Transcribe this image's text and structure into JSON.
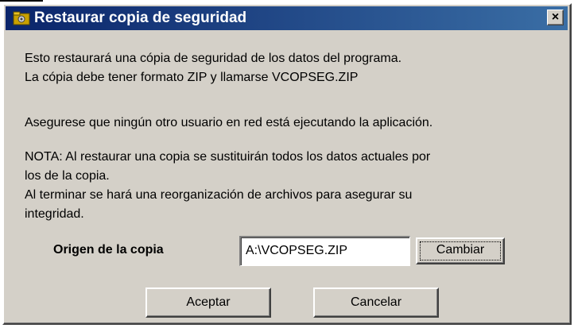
{
  "dialog": {
    "title": "Restaurar copia de seguridad",
    "close_glyph": "×",
    "icons": {
      "title": "folder-icon",
      "close": "close-icon"
    },
    "paragraphs": [
      "Esto restaurará una cópia de seguridad de los datos del programa.",
      "La cópia debe tener formato ZIP y llamarse VCOPSEG.ZIP",
      "Asegurese que ningún otro usuario en red está ejecutando la aplicación.",
      "NOTA: Al restaurar una copia se sustituirán todos los datos actuales por",
      "los de la copia.",
      "Al terminar se hará una reorganización de archivos para asegurar su",
      "integridad."
    ],
    "origin": {
      "label": "Origen de la copia",
      "value": "A:\\VCOPSEG.ZIP",
      "change_button": "Cambiar"
    },
    "buttons": {
      "accept": "Aceptar",
      "cancel": "Cancelar"
    },
    "colors": {
      "titlebar_start": "#0a246a",
      "titlebar_end": "#3a6ea5",
      "face": "#d4d0c8"
    }
  }
}
